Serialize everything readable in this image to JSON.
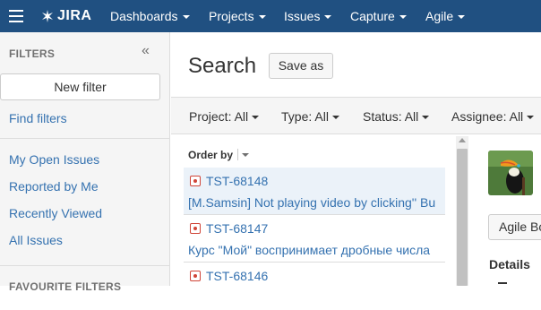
{
  "app": {
    "logo_text": "JIRA",
    "nav": [
      "Dashboards",
      "Projects",
      "Issues",
      "Capture",
      "Agile"
    ]
  },
  "sidebar": {
    "heading": "FILTERS",
    "collapse_glyph": "«",
    "new_filter_label": "New filter",
    "find_filters_label": "Find filters",
    "system_filters": [
      "My Open Issues",
      "Reported by Me",
      "Recently Viewed",
      "All Issues"
    ],
    "favourite_heading": "FAVOURITE FILTERS"
  },
  "page": {
    "title": "Search",
    "save_as_label": "Save as"
  },
  "filters": [
    {
      "label": "Project:",
      "value": "All"
    },
    {
      "label": "Type:",
      "value": "All"
    },
    {
      "label": "Status:",
      "value": "All"
    },
    {
      "label": "Assignee:",
      "value": "All"
    }
  ],
  "results": {
    "order_by_label": "Order by",
    "issues": [
      {
        "key": "TST-68148",
        "summary": "[M.Samsin] Not playing video by clicking'' Bu",
        "selected": true
      },
      {
        "key": "TST-68147",
        "summary": "Курс \"Мой\" воспринимает дробные числа",
        "selected": false
      },
      {
        "key": "TST-68146",
        "summary": "",
        "selected": false
      }
    ]
  },
  "detail": {
    "agile_button_label": "Agile Bo",
    "details_heading": "Details"
  },
  "colors": {
    "header_bg": "#205081",
    "link": "#3572b0",
    "bug": "#d04437",
    "selected_row_bg": "#ebf2f9"
  }
}
